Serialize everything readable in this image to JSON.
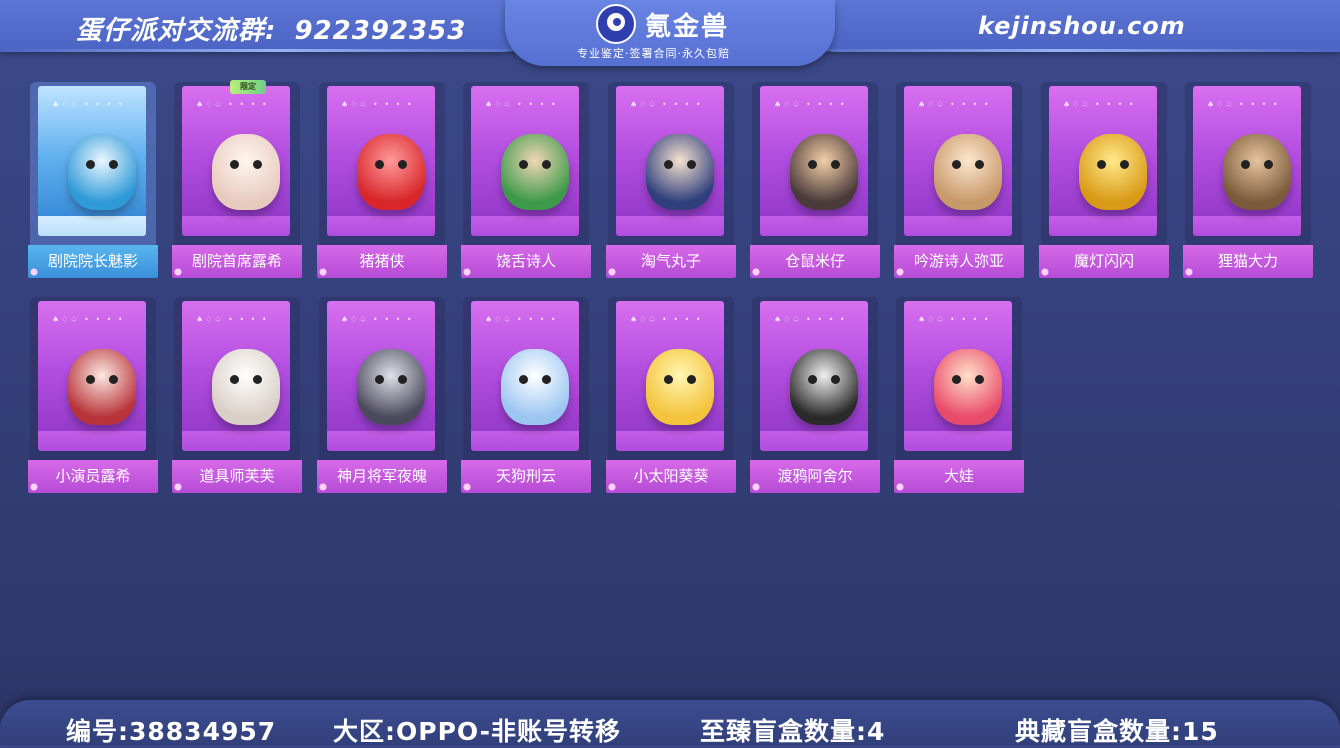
{
  "header": {
    "group_label": "蛋仔派对交流群:",
    "group_number": "922392353",
    "logo_name": "氪金兽",
    "logo_tagline": "专业鉴定·签署合同·永久包赔",
    "site_url": "kejinshou.com"
  },
  "badge": "限定",
  "cards": [
    {
      "name": "剧院院长魅影",
      "icon": "phantom-figure-icon",
      "color1": "#eaf6ff",
      "color2": "#2f9ad8",
      "tier": "gold"
    },
    {
      "name": "剧院首席露希",
      "icon": "angel-sheep-figure-icon",
      "color1": "#fff6ee",
      "color2": "#e8cbbf",
      "tier": "purple"
    },
    {
      "name": "猪猪侠",
      "icon": "pig-hero-figure-icon",
      "color1": "#ff9a9a",
      "color2": "#d8262a",
      "tier": "purple"
    },
    {
      "name": "饶舌诗人",
      "icon": "rapper-figure-icon",
      "color1": "#f1d6b6",
      "color2": "#3c9a49",
      "tier": "purple"
    },
    {
      "name": "淘气丸子",
      "icon": "mischief-ball-figure-icon",
      "color1": "#f6e2d0",
      "color2": "#2f3f7c",
      "tier": "purple"
    },
    {
      "name": "仓鼠米仔",
      "icon": "hamster-figure-icon",
      "color1": "#f3cfa8",
      "color2": "#4a3a3a",
      "tier": "purple"
    },
    {
      "name": "吟游诗人弥亚",
      "icon": "bard-deer-figure-icon",
      "color1": "#fde6cf",
      "color2": "#c89a6a",
      "tier": "purple"
    },
    {
      "name": "魔灯闪闪",
      "icon": "magic-lamp-figure-icon",
      "color1": "#ffe98a",
      "color2": "#d99a17",
      "tier": "purple"
    },
    {
      "name": "狸猫大力",
      "icon": "raccoon-figure-icon",
      "color1": "#e6c59d",
      "color2": "#7a5a3a",
      "tier": "purple"
    },
    {
      "name": "小演员露希",
      "icon": "little-actor-figure-icon",
      "color1": "#fbe8e0",
      "color2": "#b8333a",
      "tier": "purple"
    },
    {
      "name": "道具师芙芙",
      "icon": "prop-master-figure-icon",
      "color1": "#ffffff",
      "color2": "#d9cfc7",
      "tier": "purple"
    },
    {
      "name": "神月将军夜魄",
      "icon": "moon-general-figure-icon",
      "color1": "#e0e0e8",
      "color2": "#4a4a5c",
      "tier": "purple"
    },
    {
      "name": "天狗刑云",
      "icon": "tengu-figure-icon",
      "color1": "#ffffff",
      "color2": "#9cc6f2",
      "tier": "purple"
    },
    {
      "name": "小太阳葵葵",
      "icon": "little-sun-figure-icon",
      "color1": "#fff6b0",
      "color2": "#f4c33c",
      "tier": "purple"
    },
    {
      "name": "渡鸦阿舍尔",
      "icon": "raven-figure-icon",
      "color1": "#f0f0f0",
      "color2": "#2a2a2a",
      "tier": "purple"
    },
    {
      "name": "大娃",
      "icon": "calabash-brother-figure-icon",
      "color1": "#ffe0c8",
      "color2": "#e94b6a",
      "tier": "purple"
    }
  ],
  "footer": {
    "account_id": "编号:38834957",
    "region": "大区:OPPO-非账号转移",
    "premium_box_count": "至臻盲盒数量:4",
    "collection_box_count": "典藏盲盒数量:15"
  }
}
